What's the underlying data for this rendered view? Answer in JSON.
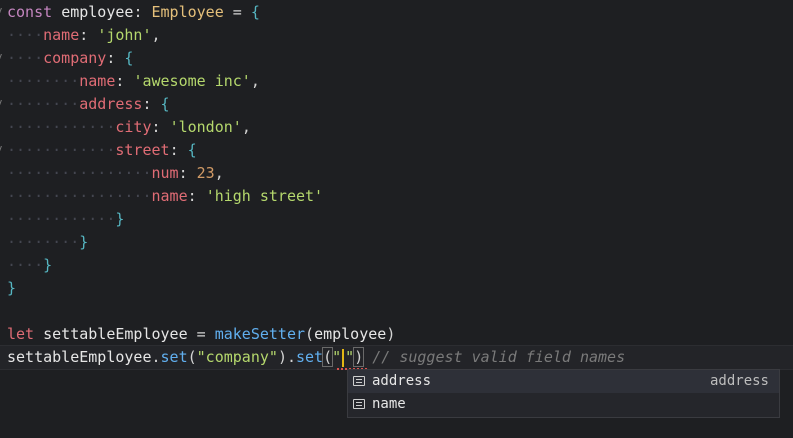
{
  "code": {
    "l1": {
      "kw": "const",
      "name": "employee",
      "type": "Employee"
    },
    "l2": {
      "dots": "····",
      "prop": "name",
      "val": "'john'"
    },
    "l3": {
      "dots": "····",
      "prop": "company"
    },
    "l4": {
      "dots": "········",
      "prop": "name",
      "val": "'awesome inc'"
    },
    "l5": {
      "dots": "········",
      "prop": "address"
    },
    "l6": {
      "dots": "············",
      "prop": "city",
      "val": "'london'"
    },
    "l7": {
      "dots": "············",
      "prop": "street"
    },
    "l8": {
      "dots": "················",
      "prop": "num",
      "val": "23"
    },
    "l9": {
      "dots": "················",
      "prop": "name",
      "val": "'high street'"
    },
    "l10": {
      "dots": "············"
    },
    "l11": {
      "dots": "········"
    },
    "l12": {
      "dots": "····"
    },
    "l14": {
      "kw": "let",
      "name": "settableEmployee",
      "fn": "makeSetter",
      "arg": "employee"
    },
    "l15": {
      "obj": "settableEmployee",
      "m1": "set",
      "a1": "\"company\"",
      "m2": "set",
      "q1": "\"",
      "q2": "\"",
      "comment": "// suggest valid field names"
    }
  },
  "suggest": {
    "items": [
      {
        "label": "address",
        "detail": "address",
        "icon": "field-icon"
      },
      {
        "label": "name",
        "detail": "",
        "icon": "field-icon"
      }
    ]
  }
}
